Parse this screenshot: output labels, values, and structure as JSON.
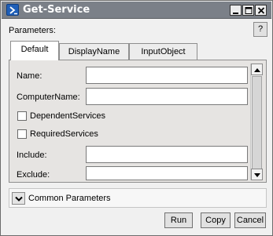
{
  "window": {
    "title": "Get-Service",
    "controls": {
      "minimize": "minimize",
      "maximize": "maximize",
      "close": "close"
    }
  },
  "header": {
    "parameters_label": "Parameters:",
    "help_label": "?"
  },
  "tabs": [
    {
      "label": "Default",
      "active": true
    },
    {
      "label": "DisplayName",
      "active": false
    },
    {
      "label": "InputObject",
      "active": false
    }
  ],
  "fields": {
    "name": {
      "label": "Name:",
      "value": ""
    },
    "computername": {
      "label": "ComputerName:",
      "value": ""
    },
    "dependentservices": {
      "label": "DependentServices",
      "checked": false
    },
    "requiredservices": {
      "label": "RequiredServices",
      "checked": false
    },
    "include": {
      "label": "Include:",
      "value": ""
    },
    "exclude": {
      "label": "Exclude:",
      "value": ""
    }
  },
  "common_parameters": {
    "label": "Common Parameters",
    "expanded": false
  },
  "buttons": {
    "run": "Run",
    "copy": "Copy",
    "cancel": "Cancel"
  },
  "colors": {
    "titlebar": "#7b8088",
    "panel": "#e6e4e2",
    "icon_blue": "#1f5fb8"
  },
  "icons": [
    "powershell-icon",
    "minimize-icon",
    "maximize-icon",
    "close-icon",
    "chevron-up-icon",
    "chevron-down-icon"
  ]
}
